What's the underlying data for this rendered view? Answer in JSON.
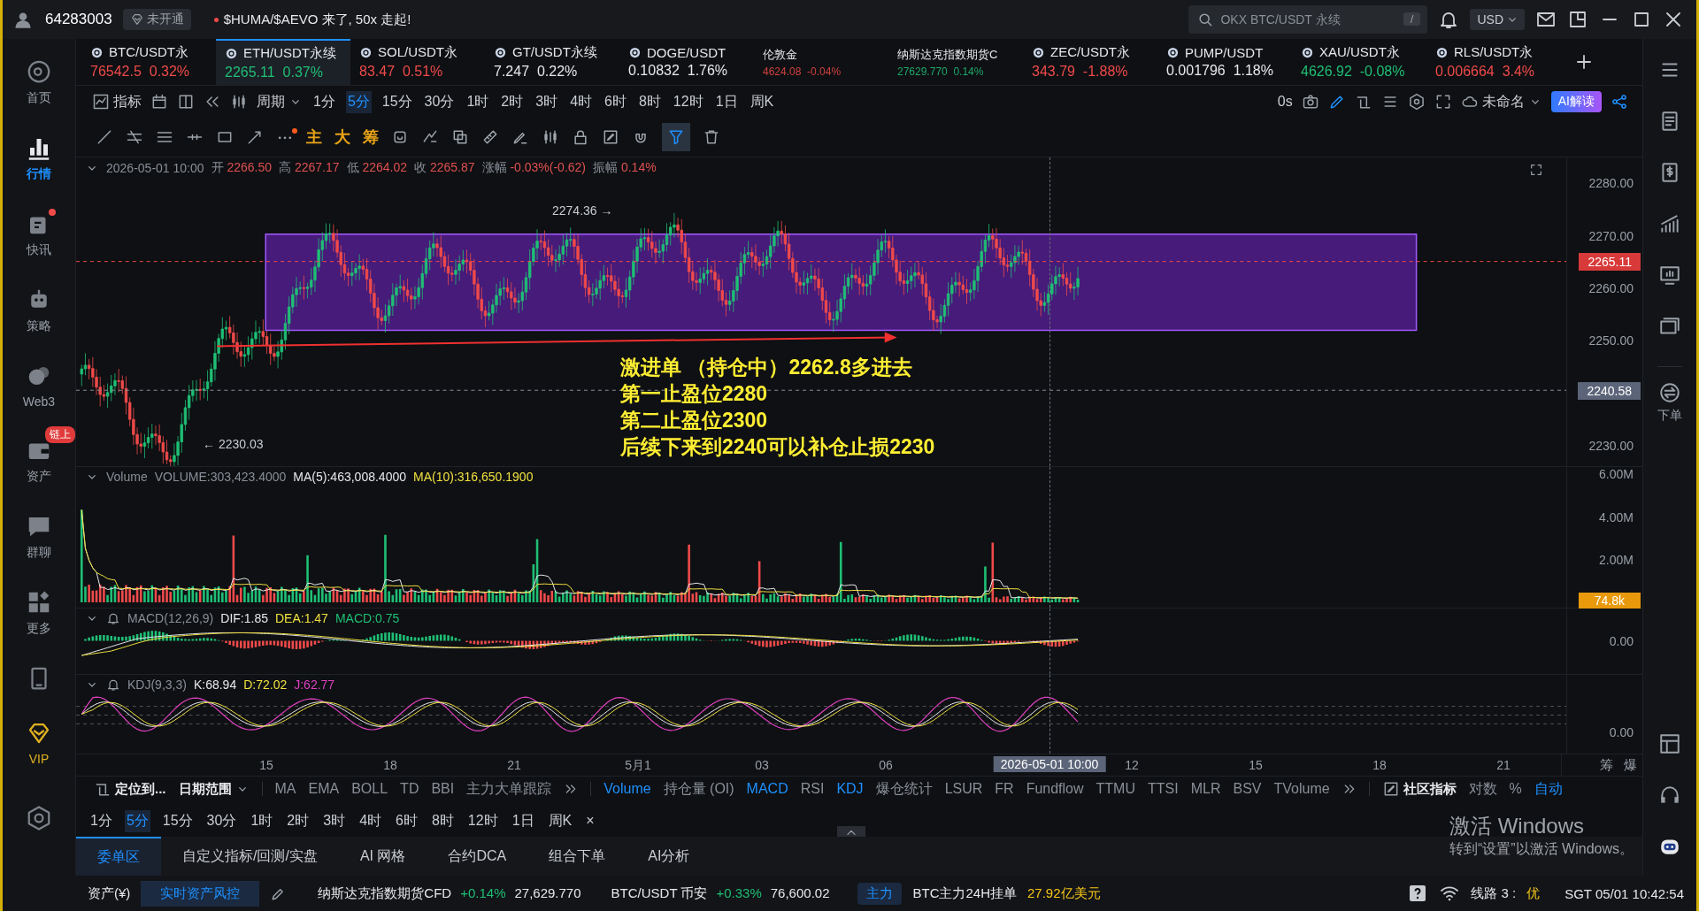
{
  "top_bar": {
    "account_id": "64283003",
    "account_badge": "未开通",
    "news": "$HUMA/$AEVO 来了, 50x 走起!",
    "search_placeholder": "OKX BTC/USDT 永续",
    "search_shortcut": "/",
    "currency": "USD"
  },
  "sidebar": {
    "items": [
      {
        "label": "首页",
        "selected": false,
        "notification": false
      },
      {
        "label": "行情",
        "selected": true,
        "notification": false
      },
      {
        "label": "快讯",
        "selected": false,
        "notification": true
      },
      {
        "label": "策略",
        "selected": false,
        "notification": false
      },
      {
        "label": "Web3",
        "selected": false,
        "notification": false
      },
      {
        "label": "资产",
        "selected": false,
        "notification": false,
        "badge": "链上"
      },
      {
        "label": "群聊",
        "selected": false,
        "notification": false
      },
      {
        "label": "更多",
        "selected": false,
        "notification": false
      }
    ],
    "vip_label": "VIP"
  },
  "tickers": [
    {
      "kind": "pair",
      "symbol": "BTC/USDT永",
      "price": "76542.5",
      "change": "0.32%",
      "color": "#f04a4a",
      "selected": false
    },
    {
      "kind": "pair",
      "symbol": "ETH/USDT永续",
      "price": "2265.11",
      "change": "0.37%",
      "color": "#1fbf75",
      "selected": true
    },
    {
      "kind": "pair",
      "symbol": "SOL/USDT永",
      "price": "83.47",
      "change": "0.51%",
      "color": "#f04a4a",
      "selected": false
    },
    {
      "kind": "pair",
      "symbol": "GT/USDT永续",
      "price": "7.247",
      "change": "0.22%",
      "color": "#e6e8eb",
      "selected": false
    },
    {
      "kind": "pair",
      "symbol": "DOGE/USDT",
      "price": "0.10832",
      "change": "1.76%",
      "color": "#e6e8eb",
      "selected": false
    },
    {
      "kind": "index",
      "symbol": "伦敦金",
      "price": "4624.08",
      "change": "-0.04%",
      "color": "#d04040",
      "selected": false
    },
    {
      "kind": "index",
      "symbol": "纳斯达克指数期货C",
      "price": "27629.770",
      "change": "0.14%",
      "color": "#1fa86a",
      "selected": false
    },
    {
      "kind": "pair",
      "symbol": "ZEC/USDT永",
      "price": "343.79",
      "change": "-1.88%",
      "color": "#f04a4a",
      "selected": false
    },
    {
      "kind": "pair",
      "symbol": "PUMP/USDT",
      "price": "0.001796",
      "change": "1.18%",
      "color": "#e6e8eb",
      "selected": false
    },
    {
      "kind": "pair",
      "symbol": "XAU/USDT永",
      "price": "4626.92",
      "change": "-0.08%",
      "color": "#1fbf75",
      "selected": false
    },
    {
      "kind": "pair",
      "symbol": "RLS/USDT永",
      "price": "0.006664",
      "change": "3.4%",
      "color": "#f04a4a",
      "selected": false
    }
  ],
  "toolbar": {
    "indicator_label": "指标",
    "period_label": "周期",
    "timeframes": [
      {
        "label": "1分",
        "selected": false
      },
      {
        "label": "5分",
        "selected": true
      },
      {
        "label": "15分",
        "selected": false
      },
      {
        "label": "30分",
        "selected": false
      },
      {
        "label": "1时",
        "selected": false
      },
      {
        "label": "2时",
        "selected": false
      },
      {
        "label": "3时",
        "selected": false
      },
      {
        "label": "4时",
        "selected": false
      },
      {
        "label": "6时",
        "selected": false
      },
      {
        "label": "8时",
        "selected": false
      },
      {
        "label": "12时",
        "selected": false
      },
      {
        "label": "1日",
        "selected": false
      },
      {
        "label": "周K",
        "selected": false
      }
    ],
    "timer": "0s",
    "layout_name": "未命名",
    "ai_button": "AI解读"
  },
  "drawing_tools": {
    "labels": [
      "主",
      "大",
      "筹"
    ]
  },
  "chart": {
    "info": {
      "datetime": "2026-05-01 10:00",
      "fields": [
        {
          "label": "开",
          "value": "2266.50"
        },
        {
          "label": "高",
          "value": "2267.17"
        },
        {
          "label": "低",
          "value": "2264.02"
        },
        {
          "label": "收",
          "value": "2265.87"
        },
        {
          "label": "涨幅",
          "value": "-0.03%(-0.62)"
        },
        {
          "label": "振幅",
          "value": "0.14%"
        }
      ]
    },
    "high_marker": "2274.36 →",
    "low_marker": "← 2230.03",
    "note": [
      "激进单 （持仓中）2262.8多进去",
      "第一止盈位2280",
      "第二止盈位2300",
      "后续下来到2240可以补仓止损2230"
    ],
    "price_axis": [
      {
        "label": "2280.00",
        "kind": "tick"
      },
      {
        "label": "2270.00",
        "kind": "tick"
      },
      {
        "label": "2265.11",
        "kind": "last"
      },
      {
        "label": "2260.00",
        "kind": "tick"
      },
      {
        "label": "2250.00",
        "kind": "tick"
      },
      {
        "label": "2240.58",
        "kind": "cursor"
      },
      {
        "label": "2230.00",
        "kind": "tick"
      }
    ],
    "volume": {
      "name": "Volume",
      "fields": [
        {
          "text": "VOLUME:303,423.4000",
          "color": "#8a8f98"
        },
        {
          "text": "MA(5):463,008.4000",
          "color": "#e6e8eb"
        },
        {
          "text": "MA(10):316,650.1900",
          "color": "#f0e040"
        }
      ],
      "axis": [
        "6.00M",
        "4.00M",
        "2.00M"
      ],
      "last": "74.8k"
    },
    "macd": {
      "name": "MACD(12,26,9)",
      "fields": [
        {
          "text": "DIF:1.85",
          "color": "#e6e8eb"
        },
        {
          "text": "DEA:1.47",
          "color": "#f0e040"
        },
        {
          "text": "MACD:0.75",
          "color": "#1fbf75"
        }
      ],
      "axis": [
        "0.00"
      ]
    },
    "kdj": {
      "name": "KDJ(9,3,3)",
      "fields": [
        {
          "text": "K:68.94",
          "color": "#e6e8eb"
        },
        {
          "text": "D:72.02",
          "color": "#f0e040"
        },
        {
          "text": "J:62.77",
          "color": "#e040c0"
        }
      ],
      "axis": [
        "0.00"
      ]
    },
    "x_axis": [
      {
        "label": "15",
        "kind": "tick"
      },
      {
        "label": "18",
        "kind": "tick"
      },
      {
        "label": "21",
        "kind": "tick"
      },
      {
        "label": "5月1",
        "kind": "tick"
      },
      {
        "label": "03",
        "kind": "tick"
      },
      {
        "label": "06",
        "kind": "tick"
      },
      {
        "label": "2026-05-01 10:00",
        "kind": "cursor"
      },
      {
        "label": "12",
        "kind": "tick"
      },
      {
        "label": "15",
        "kind": "tick"
      },
      {
        "label": "18",
        "kind": "tick"
      },
      {
        "label": "21",
        "kind": "tick"
      }
    ],
    "corner_labels": [
      "筹",
      "爆"
    ]
  },
  "indicator_bar": {
    "locate": "定位到...",
    "date_range": "日期范围",
    "main": [
      {
        "label": "MA",
        "selected": false
      },
      {
        "label": "EMA",
        "selected": false
      },
      {
        "label": "BOLL",
        "selected": false
      },
      {
        "label": "TD",
        "selected": false
      },
      {
        "label": "BBI",
        "selected": false
      },
      {
        "label": "主力大单跟踪",
        "selected": false
      }
    ],
    "sub": [
      {
        "label": "Volume",
        "selected": true
      },
      {
        "label": "持仓量 (OI)",
        "selected": false
      },
      {
        "label": "MACD",
        "selected": true
      },
      {
        "label": "RSI",
        "selected": false
      },
      {
        "label": "KDJ",
        "selected": true
      },
      {
        "label": "爆仓统计",
        "selected": false
      },
      {
        "label": "LSUR",
        "selected": false
      },
      {
        "label": "FR",
        "selected": false
      },
      {
        "label": "Fundflow",
        "selected": false
      },
      {
        "label": "TTMU",
        "selected": false
      },
      {
        "label": "TTSI",
        "selected": false
      },
      {
        "label": "MLR",
        "selected": false
      },
      {
        "label": "BSV",
        "selected": false
      },
      {
        "label": "TVolume",
        "selected": false
      }
    ],
    "community": "社区指标",
    "log": "对数",
    "percent": "%",
    "auto": {
      "label": "自动",
      "selected": true
    }
  },
  "quick_timeframes": {
    "items": [
      {
        "label": "1分",
        "selected": false
      },
      {
        "label": "5分",
        "selected": true
      },
      {
        "label": "15分",
        "selected": false
      },
      {
        "label": "30分",
        "selected": false
      },
      {
        "label": "1时",
        "selected": false
      },
      {
        "label": "2时",
        "selected": false
      },
      {
        "label": "3时",
        "selected": false
      },
      {
        "label": "4时",
        "selected": false
      },
      {
        "label": "6时",
        "selected": false
      },
      {
        "label": "8时",
        "selected": false
      },
      {
        "label": "12时",
        "selected": false
      },
      {
        "label": "1日",
        "selected": false
      },
      {
        "label": "周K",
        "selected": false
      }
    ],
    "close": "×"
  },
  "bottom_tabs": [
    {
      "label": "委单区",
      "selected": true
    },
    {
      "label": "自定义指标/回测/实盘",
      "selected": false
    },
    {
      "label": "AI 网格",
      "selected": false
    },
    {
      "label": "合约DCA",
      "selected": false
    },
    {
      "label": "组合下单",
      "selected": false
    },
    {
      "label": "AI分析",
      "selected": false
    }
  ],
  "status_bar": {
    "assets": "资产(¥)",
    "risk_button": "实时资产风控",
    "quotes": [
      {
        "name": "纳斯达克指数期货CFD",
        "change": "+0.14%",
        "price": "27,629.770"
      },
      {
        "name": "BTC/USDT 币安",
        "change": "+0.33%",
        "price": "76,600.02"
      }
    ],
    "main_badge": "主力",
    "main_label": "BTC主力24H挂单",
    "main_value": "27.92亿美元",
    "line_label": "线路 3 :",
    "line_quality": "优",
    "clock": "SGT 05/01 10:42:54"
  },
  "right_sidebar": {
    "order_label": "下单"
  },
  "windows_notice": {
    "title": "激活 Windows",
    "subtitle": "转到“设置”以激活 Windows。"
  }
}
